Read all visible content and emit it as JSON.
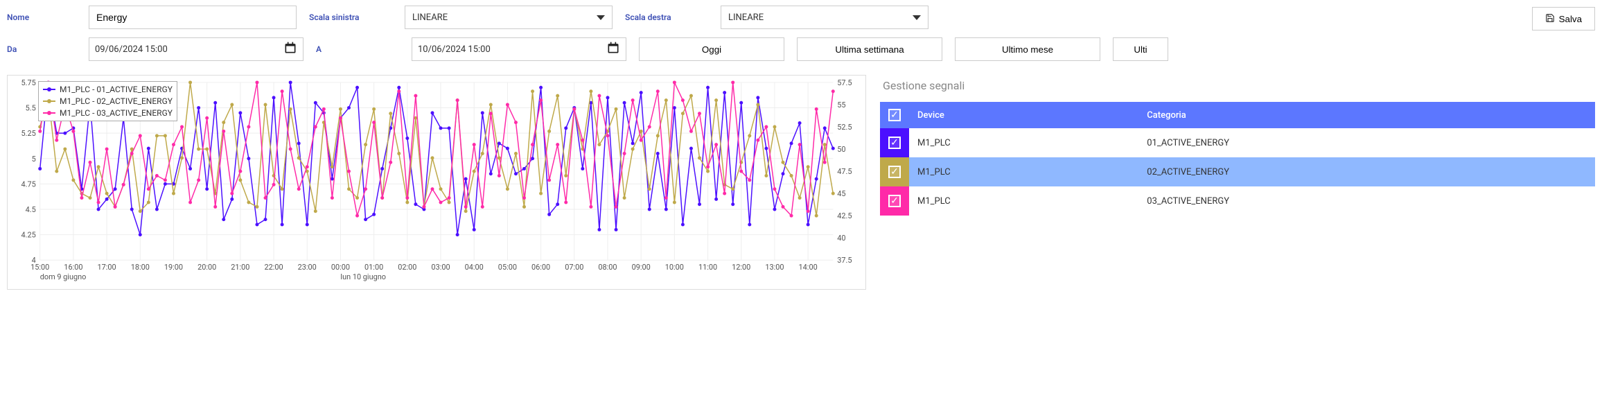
{
  "labels": {
    "nome": "Nome",
    "scala_sinistra": "Scala sinistra",
    "scala_destra": "Scala destra",
    "da": "Da",
    "a": "A",
    "salva": "Salva",
    "oggi": "Oggi",
    "ultima_settimana": "Ultima settimana",
    "ultimo_mese": "Ultimo mese",
    "ultimo": "Ulti",
    "gestione_segnali": "Gestione segnali",
    "device": "Device",
    "categoria": "Categoria"
  },
  "values": {
    "nome": "Energy",
    "scala_sinistra_sel": "LINEARE",
    "scala_destra_sel": "LINEARE",
    "da": "09/06/2024 15:00",
    "a": "10/06/2024 15:00"
  },
  "signals": [
    {
      "device": "M1_PLC",
      "categoria": "01_ACTIVE_ENERGY",
      "color": "#4b0fff",
      "checked": true
    },
    {
      "device": "M1_PLC",
      "categoria": "02_ACTIVE_ENERGY",
      "color": "#bfa94a",
      "checked": true
    },
    {
      "device": "M1_PLC",
      "categoria": "03_ACTIVE_ENERGY",
      "color": "#ff2aa8",
      "checked": true
    }
  ],
  "chart_data": {
    "type": "line",
    "title": "",
    "xlabel": "",
    "ylabel_left": "",
    "ylabel_right": "",
    "ylim_left": [
      4.0,
      5.75
    ],
    "ylim_right": [
      37.5,
      57.5
    ],
    "x_date_labels": [
      "dom 9 giugno",
      "lun 10 giugno"
    ],
    "x_ticks": [
      "15:00",
      "16:00",
      "17:00",
      "18:00",
      "19:00",
      "20:00",
      "21:00",
      "22:00",
      "23:00",
      "00:00",
      "01:00",
      "02:00",
      "03:00",
      "04:00",
      "05:00",
      "06:00",
      "07:00",
      "08:00",
      "09:00",
      "10:00",
      "11:00",
      "12:00",
      "13:00",
      "14:00"
    ],
    "left_ticks": [
      4.0,
      4.25,
      4.5,
      4.75,
      5.0,
      5.25,
      5.5,
      5.75
    ],
    "right_ticks": [
      37.5,
      40,
      42.5,
      45,
      47.5,
      50,
      52.5,
      55,
      57.5
    ],
    "x": [
      0,
      1,
      2,
      3,
      4,
      5,
      6,
      7,
      8,
      9,
      10,
      11,
      12,
      13,
      14,
      15,
      16,
      17,
      18,
      19,
      20,
      21,
      22,
      23,
      24,
      25,
      26,
      27,
      28,
      29,
      30,
      31,
      32,
      33,
      34,
      35,
      36,
      37,
      38,
      39,
      40,
      41,
      42,
      43,
      44,
      45,
      46,
      47,
      48,
      49,
      50,
      51,
      52,
      53,
      54,
      55,
      56,
      57,
      58,
      59,
      60,
      61,
      62,
      63,
      64,
      65,
      66,
      67,
      68,
      69,
      70,
      71,
      72,
      73,
      74,
      75,
      76,
      77,
      78,
      79,
      80,
      81,
      82,
      83,
      84,
      85,
      86,
      87,
      88,
      89,
      90,
      91,
      92,
      93,
      94,
      95
    ],
    "legend": [
      "M1_PLC - 01_ACTIVE_ENERGY",
      "M1_PLC - 02_ACTIVE_ENERGY",
      "M1_PLC - 03_ACTIVE_ENERGY"
    ],
    "series": [
      {
        "name": "M1_PLC - 01_ACTIVE_ENERGY",
        "color": "#4b0fff",
        "axis": "left",
        "values": [
          4.9,
          5.75,
          5.25,
          5.25,
          5.3,
          4.7,
          5.55,
          4.5,
          4.6,
          4.7,
          5.4,
          4.5,
          4.25,
          5.1,
          4.5,
          4.75,
          4.75,
          5.1,
          4.9,
          5.5,
          4.7,
          5.55,
          4.4,
          4.6,
          5.45,
          5.0,
          4.35,
          4.4,
          5.6,
          4.35,
          5.75,
          5.15,
          4.35,
          5.55,
          5.45,
          4.8,
          5.4,
          5.5,
          5.7,
          4.4,
          4.45,
          4.9,
          5.3,
          5.7,
          5.2,
          4.55,
          4.5,
          5.45,
          5.3,
          5.3,
          4.25,
          4.8,
          4.3,
          5.45,
          4.85,
          5.15,
          5.1,
          4.85,
          4.9,
          5.0,
          5.7,
          4.45,
          4.55,
          5.3,
          5.5,
          4.9,
          5.55,
          4.3,
          5.6,
          4.3,
          5.55,
          5.15,
          5.65,
          4.5,
          5.05,
          4.5,
          5.5,
          4.35,
          5.1,
          4.55,
          5.7,
          4.6,
          5.65,
          4.55,
          5.55,
          4.35,
          5.6,
          5.1,
          4.5,
          4.85,
          5.15,
          5.35,
          4.35,
          4.8,
          5.3,
          5.1
        ]
      },
      {
        "name": "M1_PLC - 02_ACTIVE_ENERGY",
        "color": "#bfa94a",
        "axis": "right",
        "values": [
          52.5,
          56.0,
          47.5,
          50.0,
          46.5,
          45.0,
          44.5,
          48.0,
          45.0,
          43.5,
          46.0,
          50.0,
          43.0,
          44.0,
          51.5,
          51.5,
          45.0,
          49.0,
          57.5,
          50.0,
          50.0,
          45.0,
          53.0,
          55.0,
          46.5,
          44.0,
          43.5,
          55.0,
          47.0,
          45.5,
          54.5,
          49.0,
          47.5,
          43.0,
          53.0,
          48.0,
          54.5,
          45.5,
          44.5,
          50.5,
          54.5,
          44.5,
          54.0,
          49.5,
          44.0,
          53.5,
          43.5,
          49.0,
          45.5,
          44.0,
          55.5,
          43.0,
          47.5,
          49.5,
          55.0,
          49.0,
          45.5,
          49.5,
          43.5,
          56.5,
          45.0,
          52.0,
          56.0,
          47.0,
          54.5,
          50.0,
          56.5,
          50.5,
          52.0,
          54.5,
          44.5,
          50.0,
          52.0,
          45.5,
          51.5,
          55.5,
          44.0,
          54.0,
          56.0,
          49.0,
          47.5,
          55.5,
          46.0,
          45.5,
          48.5,
          51.5,
          55.0,
          47.0,
          52.5,
          48.5,
          47.0,
          44.5,
          48.0,
          42.5,
          50.5,
          45.0
        ]
      },
      {
        "name": "M1_PLC - 03_ACTIVE_ENERGY",
        "color": "#ff2aa8",
        "axis": "right",
        "values": [
          52.0,
          57.5,
          51.0,
          55.0,
          52.0,
          44.5,
          48.5,
          44.0,
          50.0,
          43.5,
          46.0,
          49.5,
          51.5,
          45.5,
          47.0,
          46.5,
          50.5,
          52.5,
          44.0,
          46.5,
          53.5,
          43.5,
          52.0,
          45.0,
          47.5,
          52.5,
          57.5,
          44.5,
          46.0,
          56.5,
          50.0,
          45.5,
          48.0,
          52.5,
          54.5,
          44.5,
          53.5,
          47.5,
          42.5,
          45.5,
          53.0,
          44.5,
          48.5,
          56.5,
          44.5,
          56.0,
          43.5,
          45.5,
          44.0,
          44.5,
          55.5,
          43.5,
          50.5,
          43.5,
          54.0,
          47.0,
          55.0,
          53.0,
          44.5,
          50.5,
          55.5,
          46.5,
          50.5,
          44.0,
          54.5,
          51.0,
          43.5,
          56.0,
          51.5,
          43.5,
          49.5,
          55.5,
          51.0,
          52.5,
          56.5,
          44.5,
          57.5,
          55.5,
          52.0,
          54.0,
          48.0,
          50.5,
          45.0,
          57.5,
          47.5,
          46.5,
          51.0,
          52.5,
          45.5,
          43.5,
          42.5,
          50.5,
          43.0,
          54.5,
          48.5,
          56.5
        ]
      }
    ]
  }
}
